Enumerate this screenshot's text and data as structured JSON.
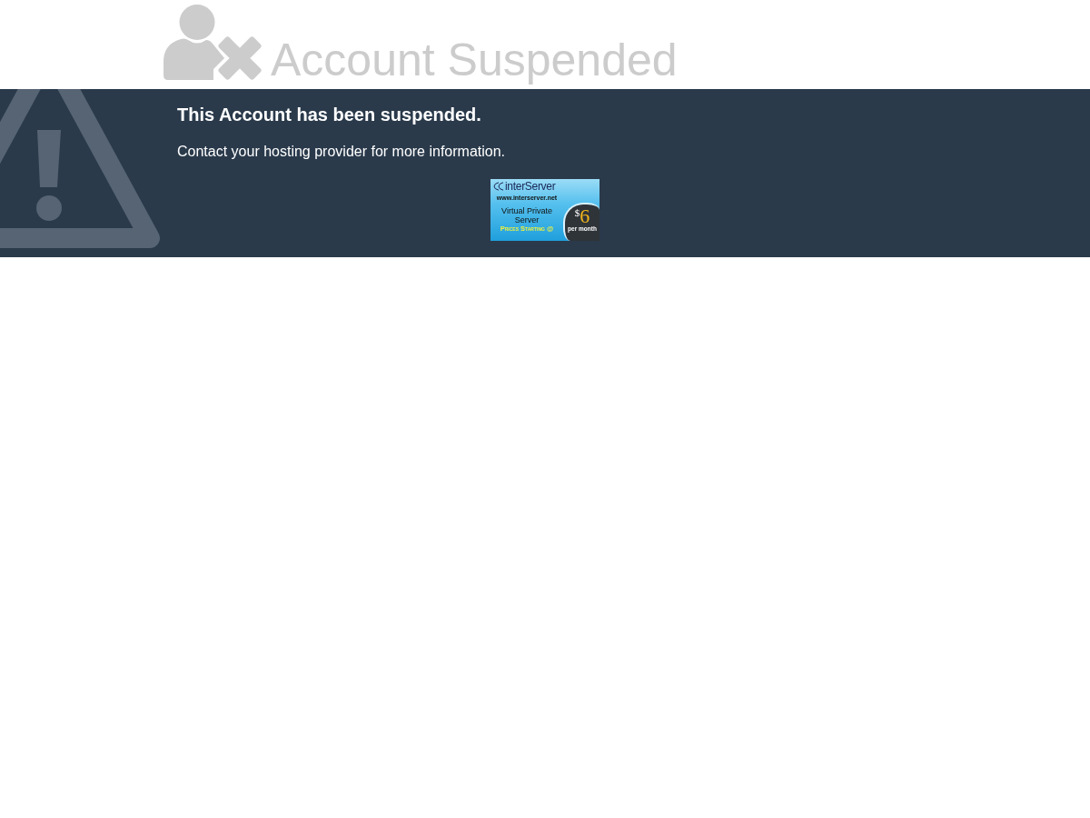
{
  "header": {
    "title": "Account Suspended"
  },
  "notice": {
    "heading": "This Account has been suspended.",
    "message": "Contact your hosting provider for more information."
  },
  "ad_banner": {
    "brand": "interServer",
    "url": "www.interserver.net",
    "headline": "Virtual Private Server",
    "tagline": "Prices Starting @",
    "currency": "$",
    "amount": "6",
    "period": "per month"
  }
}
